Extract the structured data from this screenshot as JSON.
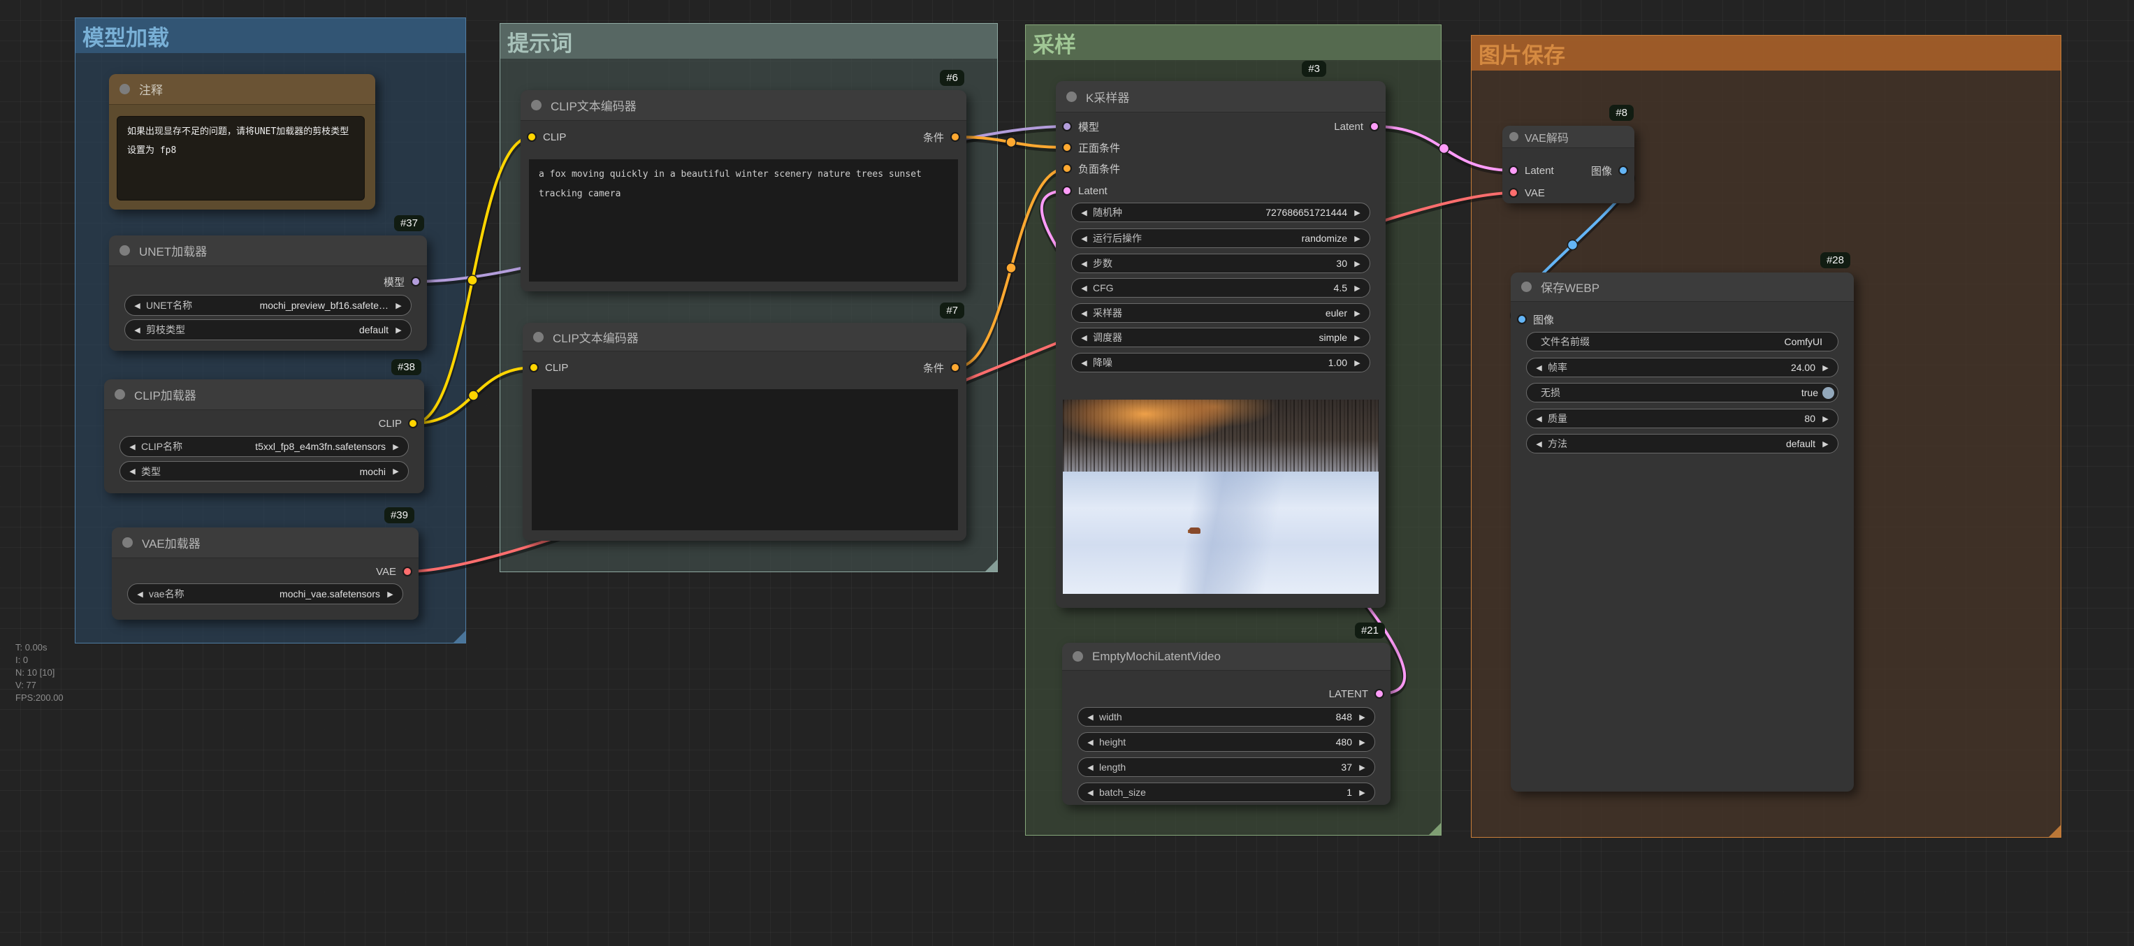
{
  "icons": {
    "arrow_left": "◀",
    "arrow_right": "▶"
  },
  "stats": {
    "lines": [
      "T: 0.00s",
      "I: 0",
      "N: 10 [10]",
      "V: 77",
      "FPS:200.00"
    ]
  },
  "groups": {
    "model_load": {
      "title": "模型加载",
      "title_color": "#79b0d6"
    },
    "prompt": {
      "title": "提示词",
      "title_color": "#a8c2ba"
    },
    "sampling": {
      "title": "采样",
      "title_color": "#a0c795"
    },
    "image_save": {
      "title": "图片保存",
      "title_color": "#d58a41"
    }
  },
  "nodes": {
    "note": {
      "title": "注释",
      "body": "如果出现显存不足的问题，请将UNET加载器的剪枝类型设置为 fp8"
    },
    "unet_loader": {
      "badge": "#37",
      "title": "UNET加载器",
      "outputs": {
        "model": "模型"
      },
      "widgets": {
        "name": {
          "label": "UNET名称",
          "value": "mochi_preview_bf16.safete…"
        },
        "dtype": {
          "label": "剪枝类型",
          "value": "default"
        }
      }
    },
    "clip_loader": {
      "badge": "#38",
      "title": "CLIP加载器",
      "outputs": {
        "clip": "CLIP"
      },
      "widgets": {
        "name": {
          "label": "CLIP名称",
          "value": "t5xxl_fp8_e4m3fn.safetensors"
        },
        "type": {
          "label": "类型",
          "value": "mochi"
        }
      }
    },
    "vae_loader": {
      "badge": "#39",
      "title": "VAE加载器",
      "outputs": {
        "vae": "VAE"
      },
      "widgets": {
        "name": {
          "label": "vae名称",
          "value": "mochi_vae.safetensors"
        }
      }
    },
    "clip_encode_pos": {
      "badge": "#6",
      "title": "CLIP文本编码器",
      "inputs": {
        "clip": "CLIP"
      },
      "outputs": {
        "cond": "条件"
      },
      "text": "a fox moving quickly in a beautiful winter scenery nature trees sunset tracking camera"
    },
    "clip_encode_neg": {
      "badge": "#7",
      "title": "CLIP文本编码器",
      "inputs": {
        "clip": "CLIP"
      },
      "outputs": {
        "cond": "条件"
      },
      "text": ""
    },
    "ksampler": {
      "badge": "#3",
      "title": "K采样器",
      "inputs": {
        "model": "模型",
        "positive": "正面条件",
        "negative": "负面条件",
        "latent": "Latent"
      },
      "outputs": {
        "latent": "Latent"
      },
      "widgets": {
        "seed": {
          "label": "随机种",
          "value": "727686651721444"
        },
        "control": {
          "label": "运行后操作",
          "value": "randomize"
        },
        "steps": {
          "label": "步数",
          "value": "30"
        },
        "cfg": {
          "label": "CFG",
          "value": "4.5"
        },
        "sampler": {
          "label": "采样器",
          "value": "euler"
        },
        "scheduler": {
          "label": "调度器",
          "value": "simple"
        },
        "denoise": {
          "label": "降噪",
          "value": "1.00"
        }
      }
    },
    "empty_latent": {
      "badge": "#21",
      "title": "EmptyMochiLatentVideo",
      "outputs": {
        "latent": "LATENT"
      },
      "widgets": {
        "width": {
          "label": "width",
          "value": "848"
        },
        "height": {
          "label": "height",
          "value": "480"
        },
        "length": {
          "label": "length",
          "value": "37"
        },
        "batch": {
          "label": "batch_size",
          "value": "1"
        }
      }
    },
    "vae_decode": {
      "badge": "#8",
      "title": "VAE解码",
      "inputs": {
        "latent": "Latent",
        "vae": "VAE"
      },
      "outputs": {
        "image": "图像"
      }
    },
    "save_webp": {
      "badge": "#28",
      "title": "保存WEBP",
      "inputs": {
        "image": "图像"
      },
      "widgets": {
        "prefix": {
          "label": "文件名前缀",
          "value": "ComfyUI"
        },
        "fps": {
          "label": "帧率",
          "value": "24.00"
        },
        "lossless": {
          "label": "无损",
          "value": "true"
        },
        "quality": {
          "label": "质量",
          "value": "80"
        },
        "method": {
          "label": "方法",
          "value": "default"
        }
      }
    }
  },
  "colors": {
    "model": "#B39DDB",
    "clip": "#FFD500",
    "conditioning": "#FFA931",
    "latent": "#FF9CF9",
    "vae": "#FF6E6E",
    "image": "#64B5F6"
  }
}
